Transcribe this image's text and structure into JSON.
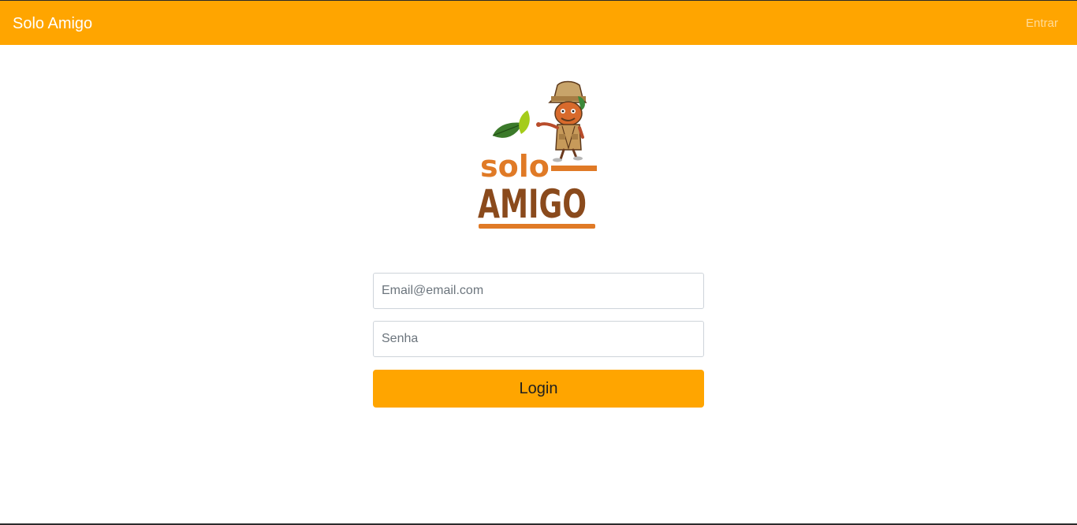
{
  "navbar": {
    "brand": "Solo Amigo",
    "login_link": "Entrar",
    "background_color": "#ffa500"
  },
  "logo": {
    "line1": "solo",
    "line2": "AMIGO"
  },
  "form": {
    "email_placeholder": "Email@email.com",
    "password_placeholder": "Senha",
    "login_label": "Login"
  }
}
